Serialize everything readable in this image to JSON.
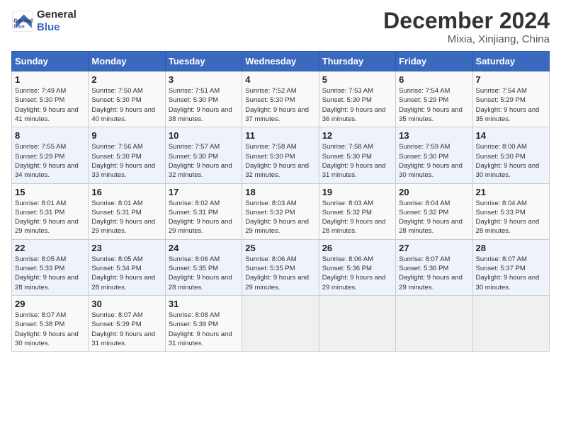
{
  "logo": {
    "line1": "General",
    "line2": "Blue"
  },
  "title": "December 2024",
  "subtitle": "Mixia, Xinjiang, China",
  "weekdays": [
    "Sunday",
    "Monday",
    "Tuesday",
    "Wednesday",
    "Thursday",
    "Friday",
    "Saturday"
  ],
  "weeks": [
    [
      {
        "day": "1",
        "sunrise": "7:49 AM",
        "sunset": "5:30 PM",
        "daylight": "9 hours and 41 minutes."
      },
      {
        "day": "2",
        "sunrise": "7:50 AM",
        "sunset": "5:30 PM",
        "daylight": "9 hours and 40 minutes."
      },
      {
        "day": "3",
        "sunrise": "7:51 AM",
        "sunset": "5:30 PM",
        "daylight": "9 hours and 38 minutes."
      },
      {
        "day": "4",
        "sunrise": "7:52 AM",
        "sunset": "5:30 PM",
        "daylight": "9 hours and 37 minutes."
      },
      {
        "day": "5",
        "sunrise": "7:53 AM",
        "sunset": "5:30 PM",
        "daylight": "9 hours and 36 minutes."
      },
      {
        "day": "6",
        "sunrise": "7:54 AM",
        "sunset": "5:29 PM",
        "daylight": "9 hours and 35 minutes."
      },
      {
        "day": "7",
        "sunrise": "7:54 AM",
        "sunset": "5:29 PM",
        "daylight": "9 hours and 35 minutes."
      }
    ],
    [
      {
        "day": "8",
        "sunrise": "7:55 AM",
        "sunset": "5:29 PM",
        "daylight": "9 hours and 34 minutes."
      },
      {
        "day": "9",
        "sunrise": "7:56 AM",
        "sunset": "5:30 PM",
        "daylight": "9 hours and 33 minutes."
      },
      {
        "day": "10",
        "sunrise": "7:57 AM",
        "sunset": "5:30 PM",
        "daylight": "9 hours and 32 minutes."
      },
      {
        "day": "11",
        "sunrise": "7:58 AM",
        "sunset": "5:30 PM",
        "daylight": "9 hours and 32 minutes."
      },
      {
        "day": "12",
        "sunrise": "7:58 AM",
        "sunset": "5:30 PM",
        "daylight": "9 hours and 31 minutes."
      },
      {
        "day": "13",
        "sunrise": "7:59 AM",
        "sunset": "5:30 PM",
        "daylight": "9 hours and 30 minutes."
      },
      {
        "day": "14",
        "sunrise": "8:00 AM",
        "sunset": "5:30 PM",
        "daylight": "9 hours and 30 minutes."
      }
    ],
    [
      {
        "day": "15",
        "sunrise": "8:01 AM",
        "sunset": "5:31 PM",
        "daylight": "9 hours and 29 minutes."
      },
      {
        "day": "16",
        "sunrise": "8:01 AM",
        "sunset": "5:31 PM",
        "daylight": "9 hours and 29 minutes."
      },
      {
        "day": "17",
        "sunrise": "8:02 AM",
        "sunset": "5:31 PM",
        "daylight": "9 hours and 29 minutes."
      },
      {
        "day": "18",
        "sunrise": "8:03 AM",
        "sunset": "5:32 PM",
        "daylight": "9 hours and 29 minutes."
      },
      {
        "day": "19",
        "sunrise": "8:03 AM",
        "sunset": "5:32 PM",
        "daylight": "9 hours and 28 minutes."
      },
      {
        "day": "20",
        "sunrise": "8:04 AM",
        "sunset": "5:32 PM",
        "daylight": "9 hours and 28 minutes."
      },
      {
        "day": "21",
        "sunrise": "8:04 AM",
        "sunset": "5:33 PM",
        "daylight": "9 hours and 28 minutes."
      }
    ],
    [
      {
        "day": "22",
        "sunrise": "8:05 AM",
        "sunset": "5:33 PM",
        "daylight": "9 hours and 28 minutes."
      },
      {
        "day": "23",
        "sunrise": "8:05 AM",
        "sunset": "5:34 PM",
        "daylight": "9 hours and 28 minutes."
      },
      {
        "day": "24",
        "sunrise": "8:06 AM",
        "sunset": "5:35 PM",
        "daylight": "9 hours and 28 minutes."
      },
      {
        "day": "25",
        "sunrise": "8:06 AM",
        "sunset": "5:35 PM",
        "daylight": "9 hours and 29 minutes."
      },
      {
        "day": "26",
        "sunrise": "8:06 AM",
        "sunset": "5:36 PM",
        "daylight": "9 hours and 29 minutes."
      },
      {
        "day": "27",
        "sunrise": "8:07 AM",
        "sunset": "5:36 PM",
        "daylight": "9 hours and 29 minutes."
      },
      {
        "day": "28",
        "sunrise": "8:07 AM",
        "sunset": "5:37 PM",
        "daylight": "9 hours and 30 minutes."
      }
    ],
    [
      {
        "day": "29",
        "sunrise": "8:07 AM",
        "sunset": "5:38 PM",
        "daylight": "9 hours and 30 minutes."
      },
      {
        "day": "30",
        "sunrise": "8:07 AM",
        "sunset": "5:39 PM",
        "daylight": "9 hours and 31 minutes."
      },
      {
        "day": "31",
        "sunrise": "8:08 AM",
        "sunset": "5:39 PM",
        "daylight": "9 hours and 31 minutes."
      },
      {
        "day": "",
        "sunrise": "",
        "sunset": "",
        "daylight": ""
      },
      {
        "day": "",
        "sunrise": "",
        "sunset": "",
        "daylight": ""
      },
      {
        "day": "",
        "sunrise": "",
        "sunset": "",
        "daylight": ""
      },
      {
        "day": "",
        "sunrise": "",
        "sunset": "",
        "daylight": ""
      }
    ]
  ]
}
